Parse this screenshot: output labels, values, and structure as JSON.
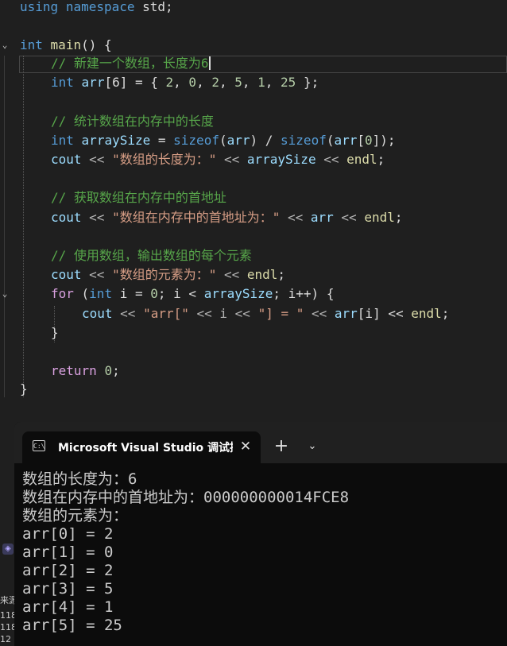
{
  "editor": {
    "line_using": [
      "using",
      "namespace",
      "std;"
    ],
    "line_main": [
      "int",
      "main",
      "() {"
    ],
    "comment_new_array": "// 新建一个数组，长度为6",
    "line_arr_decl": [
      "int",
      "arr",
      "[6] = { ",
      "2",
      ", ",
      "0",
      ", ",
      "2",
      ", ",
      "5",
      ", ",
      "1",
      ", ",
      "25",
      " };"
    ],
    "comment_count": "// 统计数组在内存中的长度",
    "line_arraysize": [
      "int",
      "arraySize",
      " = ",
      "sizeof",
      "(",
      "arr",
      ") / ",
      "sizeof",
      "(",
      "arr",
      "[",
      "0",
      "]);"
    ],
    "line_cout_length": [
      "cout",
      " << ",
      "\"数组的长度为：\"",
      " << ",
      "arraySize",
      " << ",
      "endl",
      ";"
    ],
    "comment_address": "// 获取数组在内存中的首地址",
    "line_cout_address": [
      "cout",
      " << ",
      "\"数组在内存中的首地址为：\"",
      " << ",
      "arr",
      " << ",
      "endl",
      ";"
    ],
    "comment_use": "// 使用数组，输出数组的每个元素",
    "line_cout_elements": [
      "cout",
      " << ",
      "\"数组的元素为：\"",
      " << ",
      "endl",
      ";"
    ],
    "line_for": [
      "for",
      " (",
      "int",
      " i = ",
      "0",
      "; i < ",
      "arraySize",
      "; i++) {"
    ],
    "line_cout_loop": [
      "cout",
      " << ",
      "\"arr[\"",
      " << i << ",
      "\"] = \"",
      " << ",
      "arr",
      "[i] << ",
      "endl",
      ";"
    ],
    "line_close_for": "}",
    "line_return": [
      "return",
      " ",
      "0",
      ";"
    ],
    "line_close_main": "}"
  },
  "console": {
    "tab_icon_text": "C:\\",
    "tab_title": "Microsoft Visual Studio 调试控",
    "close_glyph": "✕",
    "new_tab_glyph": "+",
    "dropdown_glyph": "⌄",
    "output": [
      "数组的长度为：6",
      "数组在内存中的首地址为：000000000014FCE8",
      "数组的元素为：",
      "arr[0] = 2",
      "arr[1] = 0",
      "arr[2] = 2",
      "arr[3] = 5",
      "arr[4] = 1",
      "arr[5] = 25"
    ]
  },
  "background_panel": {
    "fragments": [
      "来源",
      "118",
      "118",
      "12"
    ]
  },
  "colors": {
    "editor_bg": "#1f1f1f",
    "keyword": "#569cd6",
    "control_keyword": "#d8a0df",
    "function": "#dcdcaa",
    "variable": "#9cdcfe",
    "number": "#b5cea8",
    "string": "#d69d85",
    "comment": "#57a64a",
    "console_bg": "#0c0c0c",
    "console_text": "#cccccc"
  },
  "icons": {
    "fold_open": "chevron-down-icon",
    "console_tab": "console-app-icon",
    "close": "close-icon",
    "new_tab": "plus-icon",
    "dropdown": "chevron-down-icon"
  }
}
